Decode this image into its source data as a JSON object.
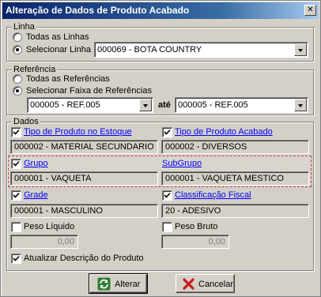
{
  "window": {
    "title": "Alteração de Dados de Produto Acabado",
    "close_glyph": "✕"
  },
  "linha": {
    "group_label": "Linha",
    "option_all": "Todas as Linhas",
    "option_select": "Selecionar Linha",
    "selected_option": "Selecionar Linha",
    "combo_value": "000069 - BOTA COUNTRY"
  },
  "referencia": {
    "group_label": "Referência",
    "option_all": "Todas as Referências",
    "option_range": "Selecionar Faixa de Referências",
    "selected_option": "Selecionar Faixa de Referências",
    "from_value": "000005 - REF.005",
    "to_label": "até",
    "to_value": "000005 - REF.005"
  },
  "dados": {
    "group_label": "Dados",
    "tipo_estoque": {
      "label": "Tipo de Produto no Estoque",
      "checked": true,
      "value": "000002 - MATERIAL SECUNDARIO"
    },
    "tipo_acabado": {
      "label": "Tipo de Produto Acabado",
      "checked": true,
      "value": "000002 - DIVERSOS"
    },
    "grupo": {
      "label": "Grupo",
      "checked": true,
      "value": "000001 - VAQUETA"
    },
    "subgrupo": {
      "label": "SubGrupo",
      "value": "000001 - VAQUETA MESTICO"
    },
    "grade": {
      "label": "Grade",
      "checked": true,
      "value": "000001 - MASCULINO"
    },
    "classificacao": {
      "label": "Classificação Fiscal",
      "checked": true,
      "value": "20 - ADESIVO"
    },
    "peso_liquido": {
      "label": "Peso Líquido",
      "checked": false,
      "value": "0,00"
    },
    "peso_bruto": {
      "label": "Peso Bruto",
      "checked": false,
      "value": "0,00"
    },
    "atualizar": {
      "label": "Atualizar Descrição do Produto",
      "checked": true
    }
  },
  "buttons": {
    "alterar": "Alterar",
    "cancelar": "Cancelar"
  },
  "colors": {
    "title_start": "#0a246a",
    "title_end": "#a6caf0",
    "link": "#0000ff",
    "face": "#d4d0c8",
    "focus_border": "#c04040"
  }
}
